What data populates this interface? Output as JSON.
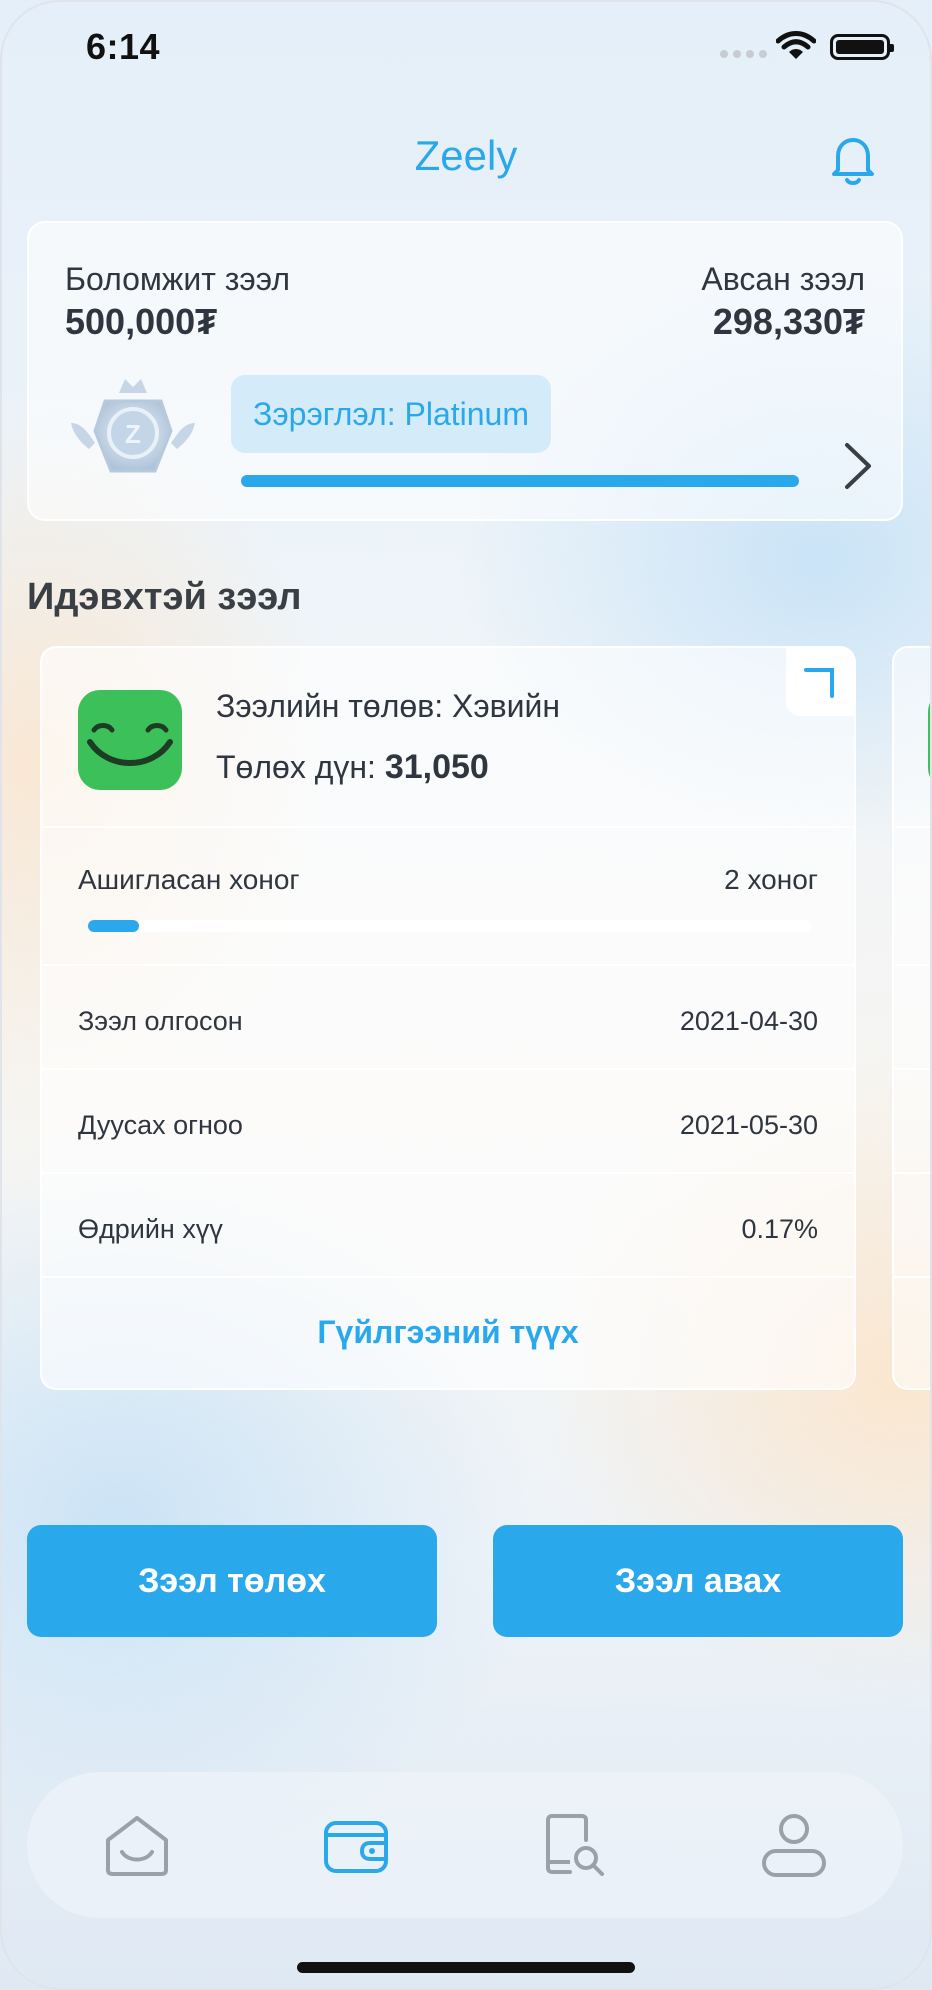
{
  "status_bar": {
    "time": "6:14"
  },
  "header": {
    "title": "Zeely",
    "notification_icon": "bell-icon"
  },
  "summary": {
    "available_label": "Боломжит зээл",
    "available_value": "500,000₮",
    "taken_label": "Авсан зээл",
    "taken_value": "298,330₮",
    "tier_label": "Зэрэглэл: Platinum",
    "tier_progress": 1.0,
    "accent_color": "#2aa8ec"
  },
  "active_loans": {
    "section_title": "Идэвхтэй зээл",
    "loans": [
      {
        "status_text": "Зээлийн төлөв: Хэвийн",
        "payment_label": "Төлөх дүн:",
        "payment_value": "31,050",
        "days_used_label": "Ашигласан хоног",
        "days_used_value": "2 хоног",
        "days_used_fraction": 0.07,
        "loan_taken_label": "Зээл олгосон",
        "loan_taken_value": "2021-04-30",
        "due_date_label": "Дуусах огноо",
        "due_date_value": "2021-05-30",
        "daily_rate_label": "Өдрийн хүү",
        "daily_rate_value": "0.17%",
        "history_link": "Гүйлгээний түүх",
        "logo_color": "#3cc05a"
      }
    ]
  },
  "actions": {
    "pay_loan": "Зээл төлөх",
    "get_loan": "Зээл авах"
  },
  "tab_bar": {
    "tabs": [
      {
        "icon": "home-icon",
        "active": false
      },
      {
        "icon": "wallet-icon",
        "active": true
      },
      {
        "icon": "document-search-icon",
        "active": false
      },
      {
        "icon": "profile-icon",
        "active": false
      }
    ],
    "active_color": "#2aa8ec",
    "inactive_color": "#9aa1a9"
  }
}
